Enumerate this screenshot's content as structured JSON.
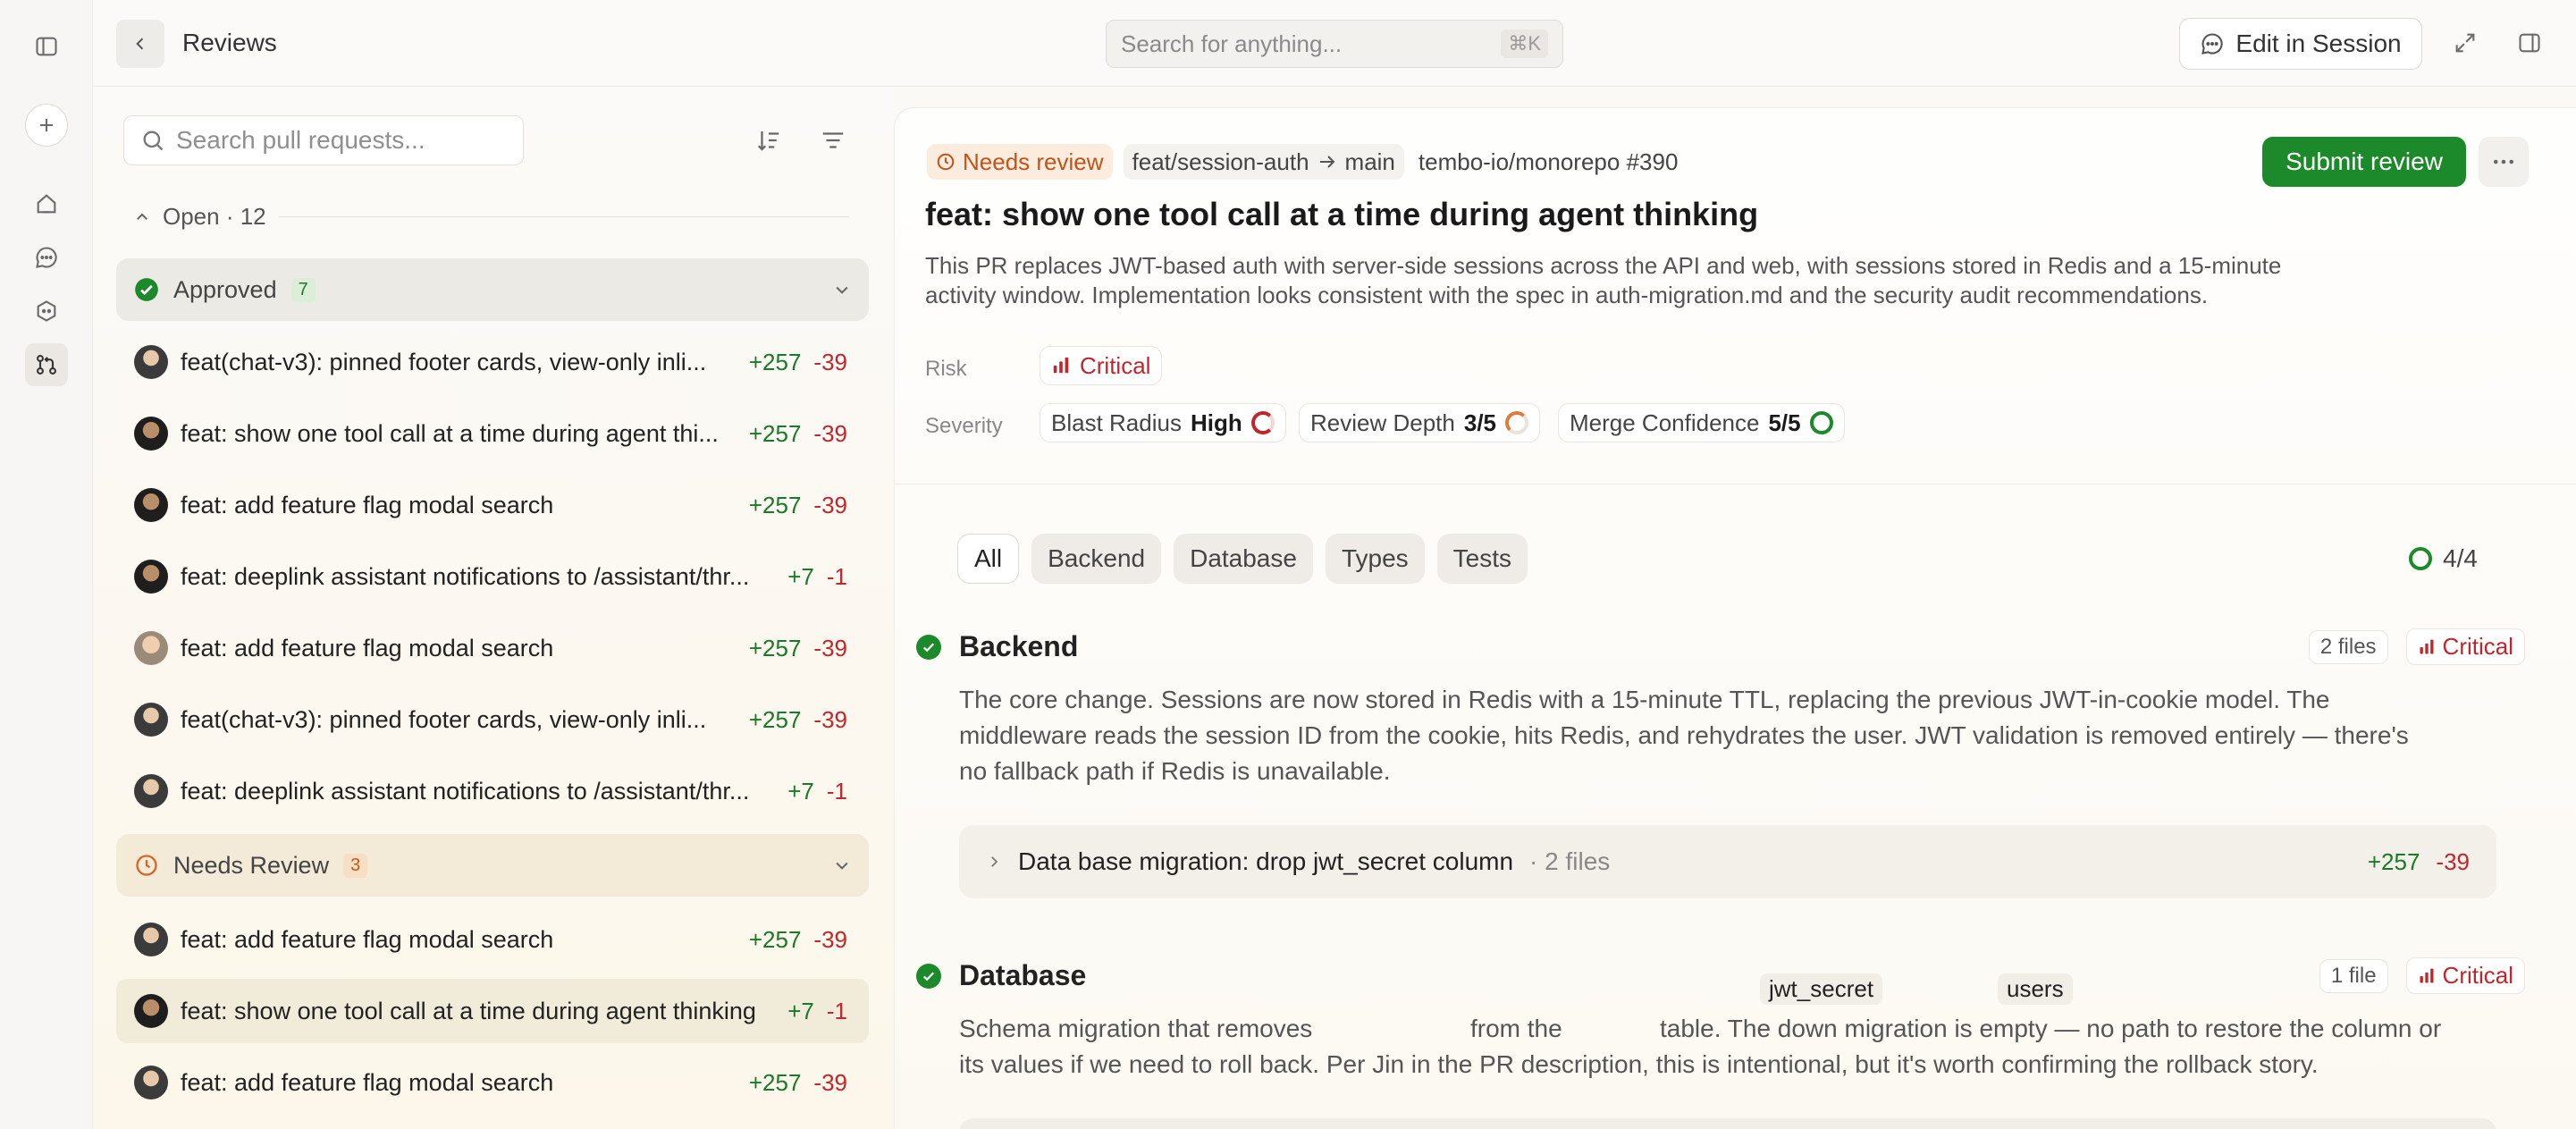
{
  "header": {
    "title": "Reviews",
    "search_placeholder": "Search for anything...",
    "search_shortcut": "⌘K",
    "edit_button": "Edit in Session"
  },
  "left": {
    "search_placeholder": "Search pull requests...",
    "open_label": "Open · 12",
    "approved": {
      "label": "Approved",
      "count": "7"
    },
    "needs_review": {
      "label": "Needs Review",
      "count": "3"
    },
    "prs": [
      {
        "title": "feat(chat-v3): pinned footer cards, view-only inli...",
        "add": "+257",
        "del": "-39"
      },
      {
        "title": "feat: show one tool call at a time during agent thi...",
        "add": "+257",
        "del": "-39"
      },
      {
        "title": "feat: add feature flag modal search",
        "add": "+257",
        "del": "-39"
      },
      {
        "title": "feat: deeplink assistant notifications to /assistant/thr...",
        "add": "+7",
        "del": "-1"
      },
      {
        "title": "feat: add feature flag modal search",
        "add": "+257",
        "del": "-39"
      },
      {
        "title": "feat(chat-v3): pinned footer cards, view-only inli...",
        "add": "+257",
        "del": "-39"
      },
      {
        "title": "feat: deeplink assistant notifications to /assistant/thr...",
        "add": "+7",
        "del": "-1"
      },
      {
        "title": "feat: add feature flag modal search",
        "add": "+257",
        "del": "-39"
      },
      {
        "title": "feat: show one tool call at a time during agent thinking",
        "add": "+7",
        "del": "-1"
      },
      {
        "title": "feat: add feature flag modal search",
        "add": "+257",
        "del": "-39"
      }
    ]
  },
  "main": {
    "status": "Needs review",
    "branch_from": "feat/session-auth",
    "branch_to": "main",
    "repo": "tembo-io/monorepo #390",
    "submit": "Submit review",
    "title": "feat: show one tool call at a time during agent thinking",
    "desc_line1": "This PR replaces JWT-based auth with server-side sessions across the API and web, with sessions stored in Redis and a 15-minute",
    "desc_line2": "activity window. Implementation looks consistent with the spec in auth-migration.md and the security audit recommendations.",
    "risk_label": "Risk",
    "risk_value": "Critical",
    "severity_label": "Severity",
    "blast_label": "Blast Radius",
    "blast_value": "High",
    "depth_label": "Review Depth",
    "depth_value": "3/5",
    "confidence_label": "Merge Confidence",
    "confidence_value": "5/5",
    "tabs": [
      "All",
      "Backend",
      "Database",
      "Types",
      "Tests"
    ],
    "progress": "4/4",
    "backend": {
      "title": "Backend",
      "files": "2 files",
      "risk": "Critical",
      "line1": "The core change. Sessions are now stored in Redis with a 15-minute TTL, replacing the previous JWT-in-cookie model. The",
      "line2": "middleware reads the session ID from the cookie, hits Redis, and rehydrates the user. JWT validation is removed entirely — there's",
      "line3": "no fallback path if Redis is unavailable.",
      "migration": {
        "title": "Data base migration: drop jwt_secret column",
        "files": "· 2 files",
        "add": "+257",
        "del": "-39"
      }
    },
    "database": {
      "title": "Database",
      "files": "1 file",
      "risk": "Critical",
      "code1": "jwt_secret",
      "code2": "users",
      "p1": "Schema migration that removes",
      "p2": "from the",
      "p3": "table. The down migration is empty — no path to restore the column or",
      "line2": "its values if we need to roll back. Per Jin in the PR description, this is intentional, but it's worth confirming the rollback story."
    }
  }
}
